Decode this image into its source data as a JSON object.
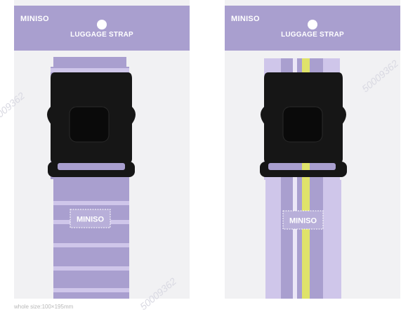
{
  "products": [
    {
      "brand": "MINISO",
      "title": "LUGGAGE STRAP",
      "tag": "MINISO",
      "style": "stripes-horizontal"
    },
    {
      "brand": "MINISO",
      "title": "LUGGAGE STRAP",
      "tag": "MINISO",
      "style": "stripes-vertical"
    }
  ],
  "colors": {
    "lavender": "#a99fcf",
    "lavender_light": "#cfc6ea",
    "yellow": "#dfe36a",
    "buckle": "#161616",
    "backing": "#f1f1f3"
  },
  "watermarks": [
    "50009362",
    "50009362",
    "50009362"
  ],
  "caption": "whole size:100×195mm"
}
